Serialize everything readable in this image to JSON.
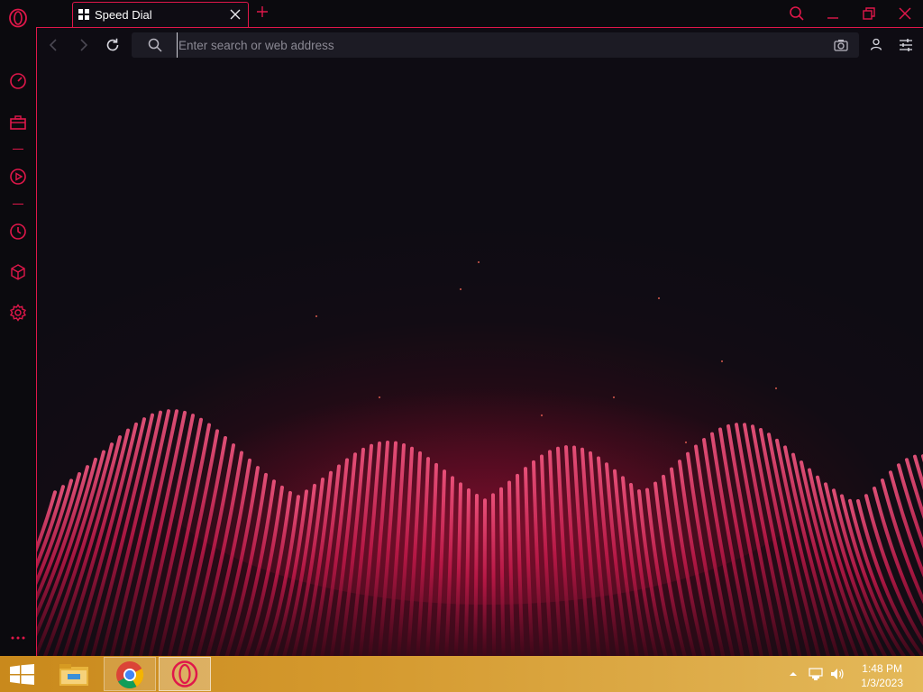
{
  "browser": {
    "tab": {
      "title": "Speed Dial"
    },
    "address_bar": {
      "placeholder": "Enter search or web address",
      "value": ""
    },
    "accent_color": "#e0174a"
  },
  "sidebar": {
    "items": [
      {
        "name": "opera-logo-icon"
      },
      {
        "name": "speed-dial-icon"
      },
      {
        "name": "workspaces-icon"
      },
      {
        "name": "player-icon"
      },
      {
        "name": "history-icon"
      },
      {
        "name": "extensions-icon"
      },
      {
        "name": "settings-icon"
      },
      {
        "name": "more-icon"
      }
    ]
  },
  "taskbar": {
    "time": "1:48 PM",
    "date": "1/3/2023",
    "apps": [
      "file-explorer",
      "chrome",
      "opera-gx"
    ]
  }
}
